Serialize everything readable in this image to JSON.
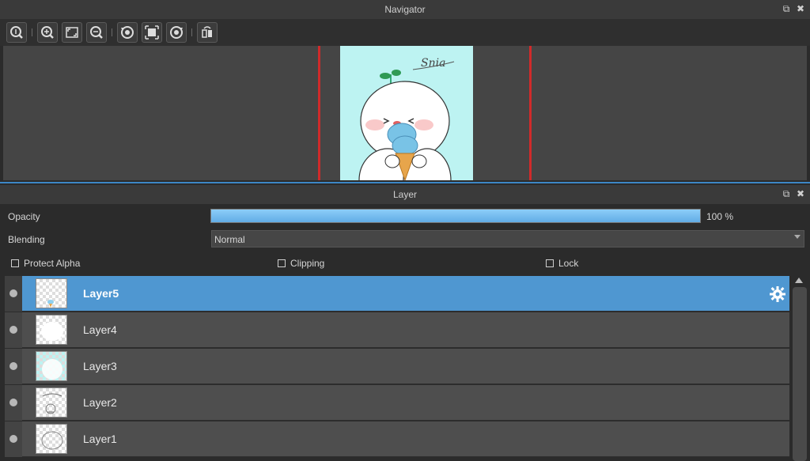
{
  "navigator": {
    "title": "Navigator",
    "toolbar_icons": [
      "zoom-fit-icon",
      "zoom-in-icon",
      "fit-screen-icon",
      "zoom-out-icon",
      "rotate-left-icon",
      "fit-window-icon",
      "rotate-right-icon",
      "flip-horizontal-icon"
    ],
    "signature": "Snia"
  },
  "layer_panel": {
    "title": "Layer",
    "opacity_label": "Opacity",
    "opacity_value": "100 %",
    "opacity_fraction": 1.0,
    "blending_label": "Blending",
    "blending_value": "Normal",
    "protect_alpha_label": "Protect Alpha",
    "clipping_label": "Clipping",
    "lock_label": "Lock",
    "layers": [
      {
        "name": "Layer5",
        "selected": true
      },
      {
        "name": "Layer4",
        "selected": false
      },
      {
        "name": "Layer3",
        "selected": false
      },
      {
        "name": "Layer2",
        "selected": false
      },
      {
        "name": "Layer1",
        "selected": false
      }
    ]
  },
  "colors": {
    "accent": "#4f97d1",
    "canvas_bg": "#bdf3f2",
    "view_border": "#d02a2a"
  }
}
